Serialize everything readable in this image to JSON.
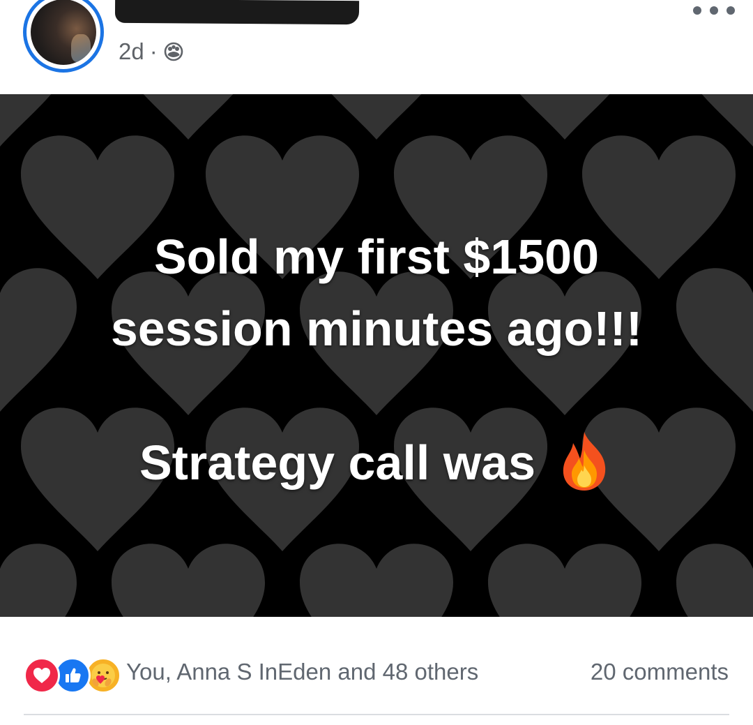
{
  "header": {
    "timestamp": "2d",
    "separator": "·",
    "audience_icon": "friends-icon",
    "more_icon": "more-options-icon"
  },
  "post_image": {
    "line1": "Sold my first $1500",
    "line2": "session minutes ago!!!",
    "line3": "Strategy call was",
    "emoji": "fire-icon",
    "background": "#000000",
    "heart_color": "#3a3a3a"
  },
  "footer": {
    "reactions": [
      "love-reaction-icon",
      "like-reaction-icon",
      "care-reaction-icon"
    ],
    "reactors_text": "You, Anna S InEden and 48 others",
    "comments_text": "20 comments"
  },
  "colors": {
    "accent": "#1b74e4",
    "love": "#f02849",
    "like": "#1877f2",
    "care": "#f7b125",
    "secondary_text": "#606770"
  }
}
